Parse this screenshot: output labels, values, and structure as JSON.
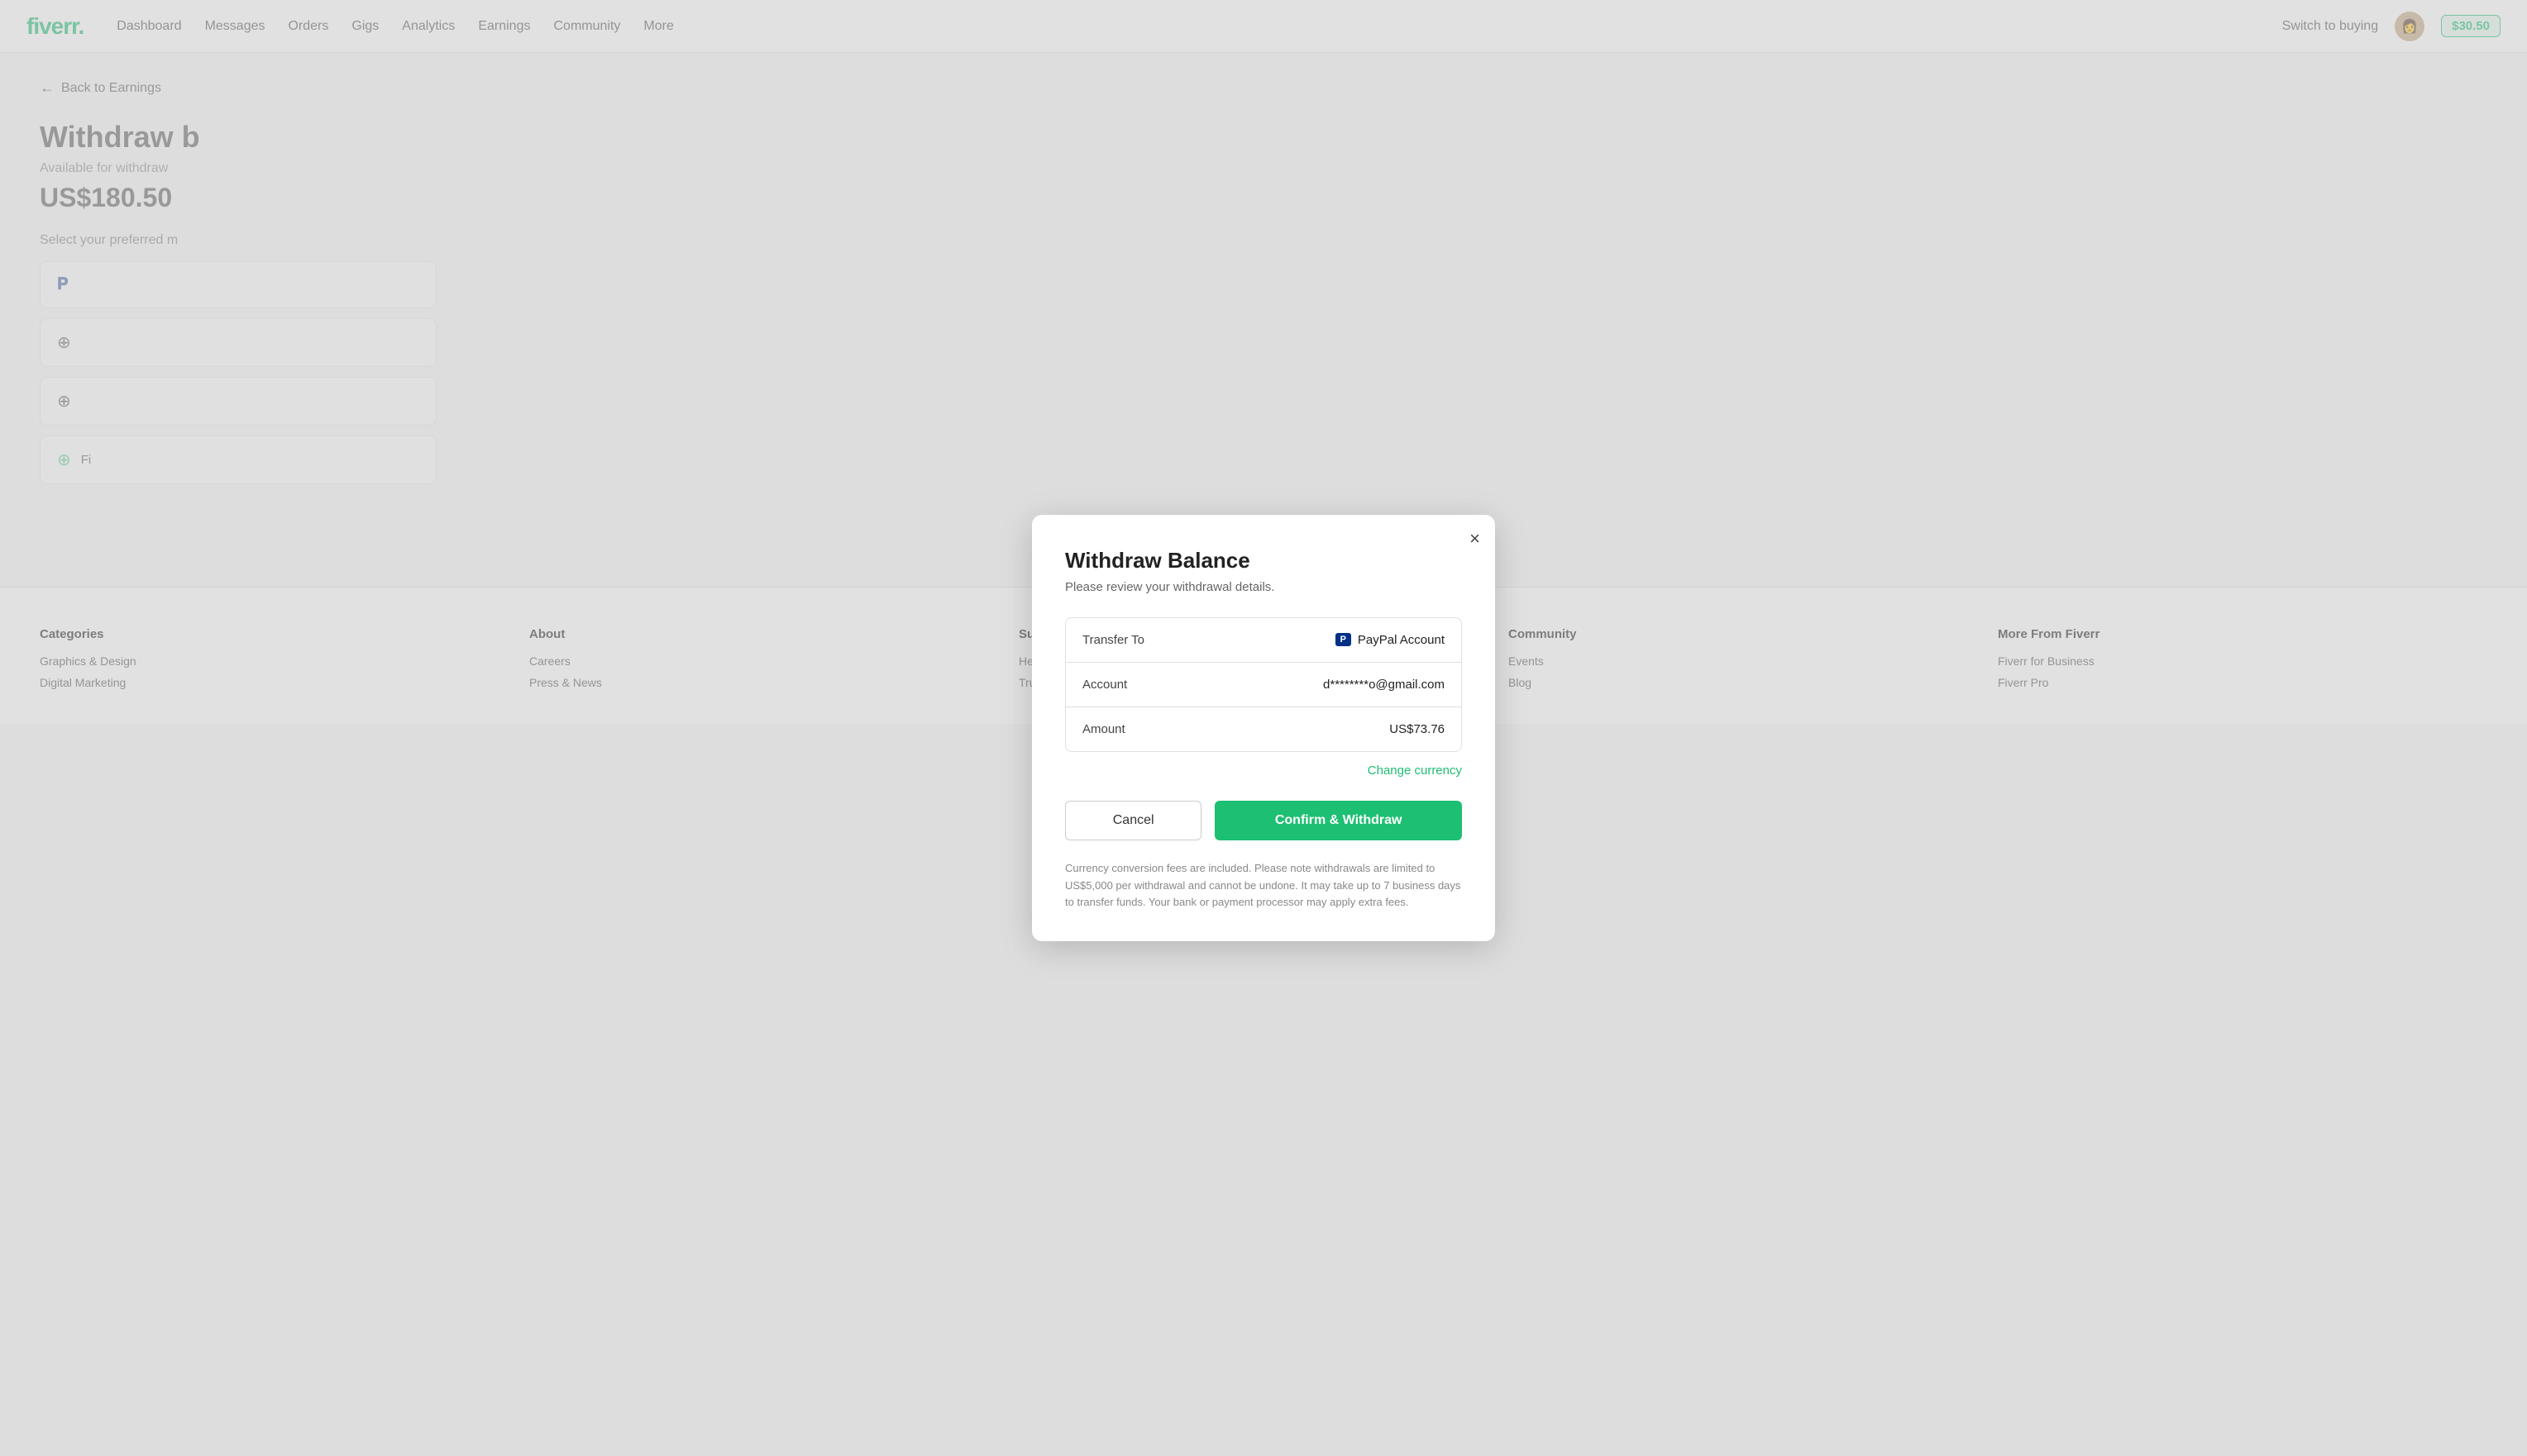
{
  "navbar": {
    "logo_text": "fiverr",
    "logo_dot": ".",
    "links": [
      "Dashboard",
      "Messages",
      "Orders",
      "Gigs",
      "Analytics",
      "Earnings",
      "Community",
      "More"
    ],
    "switch_to_buying": "Switch to buying",
    "balance": "$30.50"
  },
  "page": {
    "back_label": "Back to Earnings",
    "title": "Withdraw b",
    "available_label": "Available for withdraw",
    "available_amount": "US$180.50",
    "select_label": "Select your preferred m"
  },
  "modal": {
    "title": "Withdraw Balance",
    "subtitle": "Please review your withdrawal details.",
    "close_label": "×",
    "details": {
      "transfer_to_label": "Transfer To",
      "transfer_to_value": "PayPal Account",
      "account_label": "Account",
      "account_value": "d********o@gmail.com",
      "amount_label": "Amount",
      "amount_value": "US$73.76"
    },
    "change_currency": "Change currency",
    "cancel_label": "Cancel",
    "confirm_label": "Confirm & Withdraw",
    "disclaimer": "Currency conversion fees are included. Please note withdrawals are limited to US$5,000 per withdrawal and cannot be undone. It may take up to 7 business days to transfer funds. Your bank or payment processor may apply extra fees."
  },
  "footer": {
    "categories": {
      "title": "Categories",
      "links": [
        "Graphics & Design",
        "Digital Marketing"
      ]
    },
    "about": {
      "title": "About",
      "links": [
        "Careers",
        "Press & News"
      ]
    },
    "support": {
      "title": "Support",
      "links": [
        "Help & Support",
        "Trust & Safety"
      ]
    },
    "community": {
      "title": "Community",
      "links": [
        "Events",
        "Blog"
      ]
    },
    "more": {
      "title": "More From Fiverr",
      "links": [
        "Fiverr for Business",
        "Fiverr Pro"
      ]
    }
  }
}
